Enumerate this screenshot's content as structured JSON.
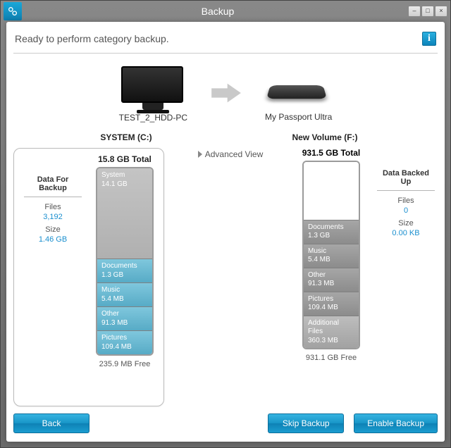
{
  "window": {
    "title": "Backup"
  },
  "status": "Ready to perform category backup.",
  "source_device": "TEST_2_HDD-PC",
  "dest_device": "My Passport Ultra",
  "source_volume": "SYSTEM (C:)",
  "dest_volume": "New Volume (F:)",
  "advanced_view": "Advanced View",
  "source": {
    "total": "15.8 GB Total",
    "free": "235.9 MB Free",
    "segments": {
      "system": {
        "name": "System",
        "size": "14.1 GB"
      },
      "documents": {
        "name": "Documents",
        "size": "1.3 GB"
      },
      "music": {
        "name": "Music",
        "size": "5.4 MB"
      },
      "other": {
        "name": "Other",
        "size": "91.3 MB"
      },
      "pictures": {
        "name": "Pictures",
        "size": "109.4 MB"
      }
    }
  },
  "dest": {
    "total": "931.5 GB Total",
    "free": "931.1 GB Free",
    "segments": {
      "documents": {
        "name": "Documents",
        "size": "1.3 GB"
      },
      "music": {
        "name": "Music",
        "size": "5.4 MB"
      },
      "other": {
        "name": "Other",
        "size": "91.3 MB"
      },
      "pictures": {
        "name": "Pictures",
        "size": "109.4 MB"
      },
      "additional": {
        "name": "Additional Files",
        "size": "360.3 MB"
      }
    }
  },
  "data_for_backup": {
    "head": "Data For Backup",
    "files_label": "Files",
    "files_value": "3,192",
    "size_label": "Size",
    "size_value": "1.46 GB"
  },
  "data_backed_up": {
    "head": "Data Backed Up",
    "files_label": "Files",
    "files_value": "0",
    "size_label": "Size",
    "size_value": "0.00 KB"
  },
  "buttons": {
    "back": "Back",
    "skip": "Skip Backup",
    "enable": "Enable Backup"
  }
}
